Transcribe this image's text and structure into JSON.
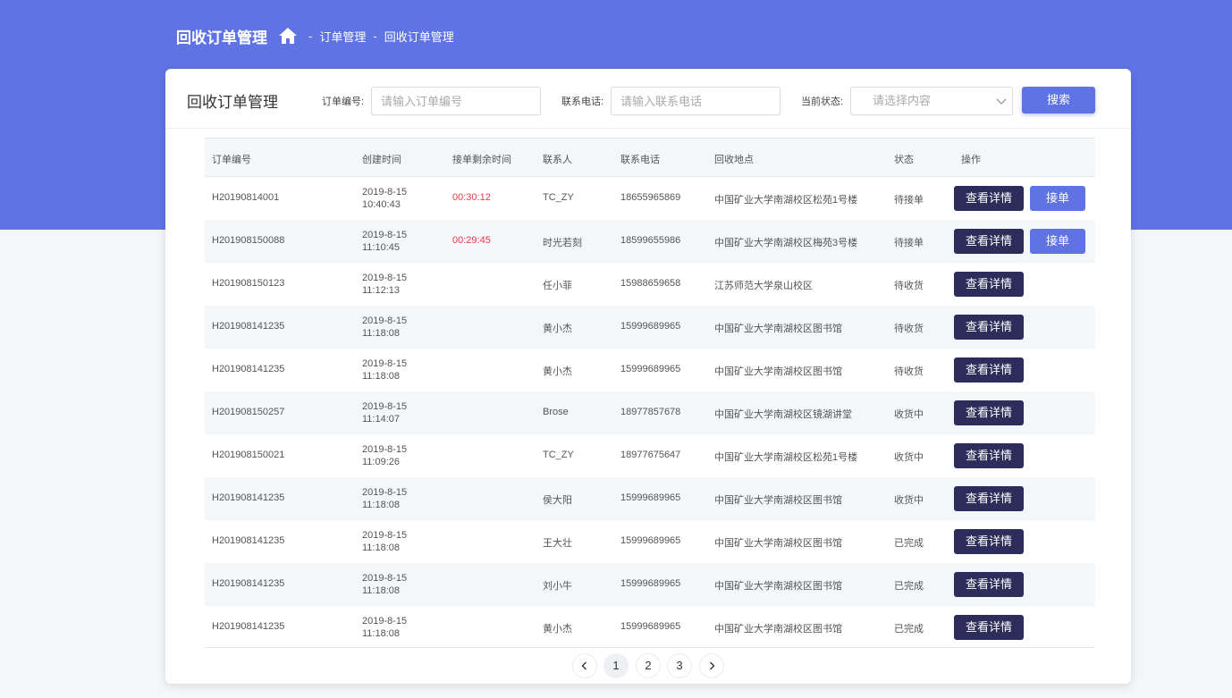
{
  "header": {
    "app_title": "回收订单管理",
    "breadcrumb": [
      {
        "sep": "-",
        "label": "订单管理"
      },
      {
        "sep": "-",
        "label": "回收订单管理"
      }
    ]
  },
  "card": {
    "title": "回收订单管理",
    "filters": {
      "order_no_label": "订单编号:",
      "order_no_placeholder": "请输入订单编号",
      "phone_label": "联系电话:",
      "phone_placeholder": "请输入联系电话",
      "status_label": "当前状态:",
      "status_placeholder": "请选择内容",
      "search_label": "搜索"
    }
  },
  "table": {
    "columns": [
      "订单编号",
      "创建时间",
      "接单剩余时间",
      "联系人",
      "联系电话",
      "回收地点",
      "状态",
      "操作"
    ],
    "detail_label": "查看详情",
    "accept_label": "接单",
    "rows": [
      {
        "order_no": "H20190814001",
        "date": "2019-8-15",
        "time": "10:40:43",
        "remaining": "00:30:12",
        "contact": "TC_ZY",
        "phone": "18655965869",
        "location": "中国矿业大学南湖校区松苑1号楼",
        "status": "待接单",
        "accept": true
      },
      {
        "order_no": "H201908150088",
        "date": "2019-8-15",
        "time": "11:10:45",
        "remaining": "00:29:45",
        "contact": "时光若刻",
        "phone": "18599655986",
        "location": "中国矿业大学南湖校区梅苑3号楼",
        "status": "待接单",
        "accept": true
      },
      {
        "order_no": "H201908150123",
        "date": "2019-8-15",
        "time": "11:12:13",
        "remaining": "",
        "contact": "任小菲",
        "phone": "15988659658",
        "location": "江苏师范大学泉山校区",
        "status": "待收货",
        "accept": false
      },
      {
        "order_no": "H201908141235",
        "date": "2019-8-15",
        "time": "11:18:08",
        "remaining": "",
        "contact": "黄小杰",
        "phone": "15999689965",
        "location": "中国矿业大学南湖校区图书馆",
        "status": "待收货",
        "accept": false
      },
      {
        "order_no": "H201908141235",
        "date": "2019-8-15",
        "time": "11:18:08",
        "remaining": "",
        "contact": "黄小杰",
        "phone": "15999689965",
        "location": "中国矿业大学南湖校区图书馆",
        "status": "待收货",
        "accept": false
      },
      {
        "order_no": "H201908150257",
        "date": "2019-8-15",
        "time": "11:14:07",
        "remaining": "",
        "contact": "Brose",
        "phone": "18977857678",
        "location": "中国矿业大学南湖校区镜湖讲堂",
        "status": "收货中",
        "accept": false
      },
      {
        "order_no": "H201908150021",
        "date": "2019-8-15",
        "time": "11:09:26",
        "remaining": "",
        "contact": "TC_ZY",
        "phone": "18977675647",
        "location": "中国矿业大学南湖校区松苑1号楼",
        "status": "收货中",
        "accept": false
      },
      {
        "order_no": "H201908141235",
        "date": "2019-8-15",
        "time": "11:18:08",
        "remaining": "",
        "contact": "侯大阳",
        "phone": "15999689965",
        "location": "中国矿业大学南湖校区图书馆",
        "status": "收货中",
        "accept": false
      },
      {
        "order_no": "H201908141235",
        "date": "2019-8-15",
        "time": "11:18:08",
        "remaining": "",
        "contact": "王大壮",
        "phone": "15999689965",
        "location": "中国矿业大学南湖校区图书馆",
        "status": "已完成",
        "accept": false
      },
      {
        "order_no": "H201908141235",
        "date": "2019-8-15",
        "time": "11:18:08",
        "remaining": "",
        "contact": "刘小牛",
        "phone": "15999689965",
        "location": "中国矿业大学南湖校区图书馆",
        "status": "已完成",
        "accept": false
      },
      {
        "order_no": "H201908141235",
        "date": "2019-8-15",
        "time": "11:18:08",
        "remaining": "",
        "contact": "黄小杰",
        "phone": "15999689965",
        "location": "中国矿业大学南湖校区图书馆",
        "status": "已完成",
        "accept": false
      }
    ]
  },
  "pagination": {
    "pages": [
      "1",
      "2",
      "3"
    ],
    "current": "1",
    "prev_icon": "chevron-left-icon",
    "next_icon": "chevron-right-icon"
  },
  "colors": {
    "brand": "#5f73e3",
    "dark_button": "#2c2d5b",
    "countdown": "#e53b4a"
  }
}
